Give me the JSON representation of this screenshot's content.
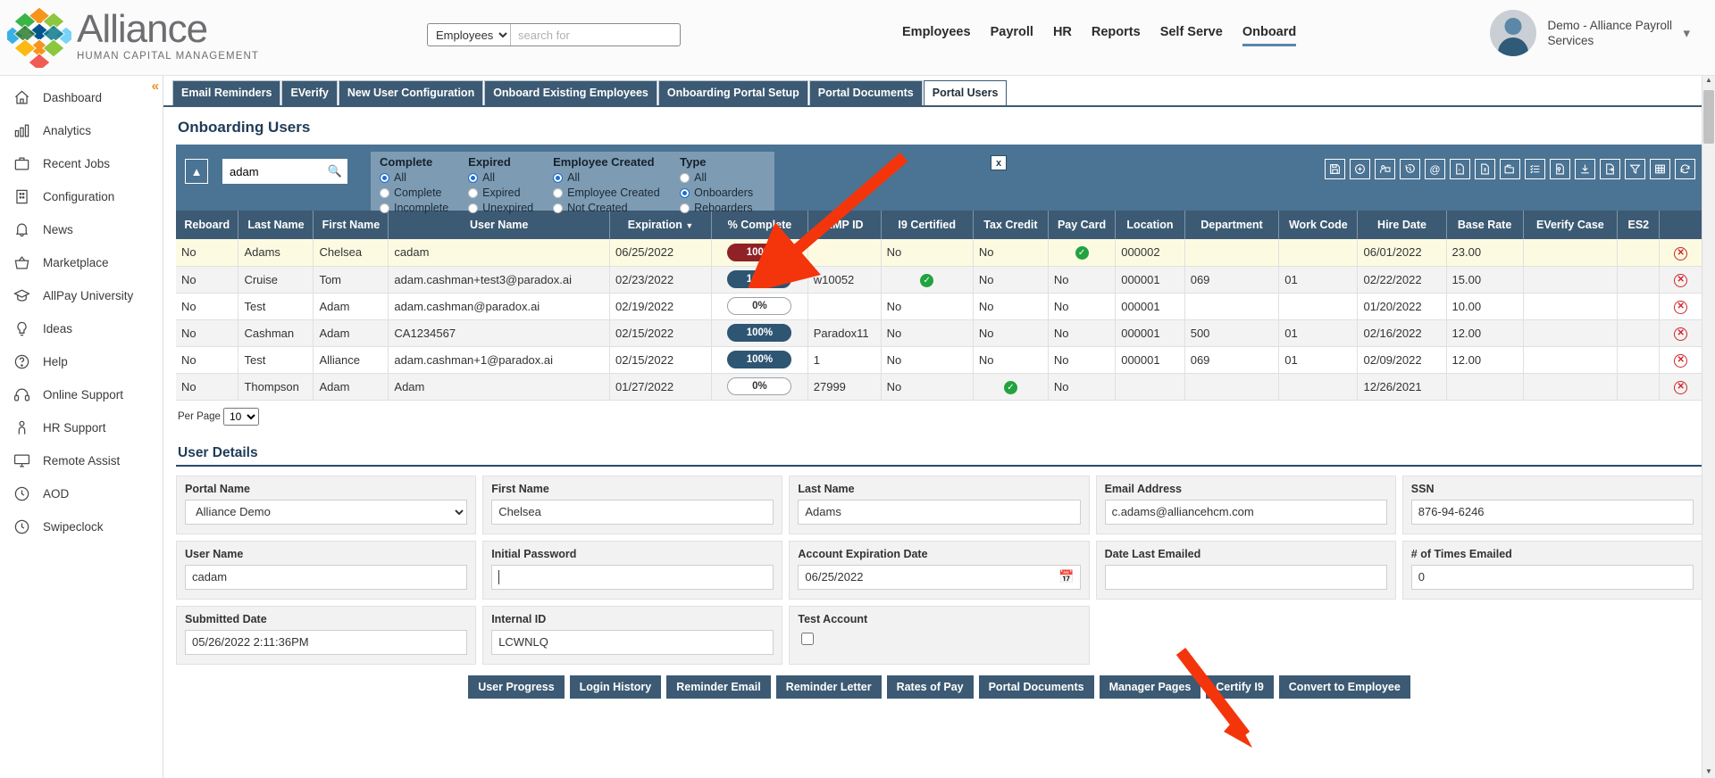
{
  "brand": {
    "name": "Alliance",
    "tagline": "HUMAN CAPITAL MANAGEMENT"
  },
  "header": {
    "search": {
      "selected": "Employees",
      "placeholder": "search for",
      "value": ""
    },
    "nav": [
      {
        "label": "Employees",
        "active": false
      },
      {
        "label": "Payroll",
        "active": false
      },
      {
        "label": "HR",
        "active": false
      },
      {
        "label": "Reports",
        "active": false
      },
      {
        "label": "Self Serve",
        "active": false
      },
      {
        "label": "Onboard",
        "active": true
      }
    ],
    "user": {
      "name": "Demo - Alliance Payroll Services",
      "caret": "chevron-down-icon"
    }
  },
  "sidebar": {
    "collapse": "«",
    "items": [
      {
        "label": "Dashboard",
        "icon": "home-icon"
      },
      {
        "label": "Analytics",
        "icon": "chart-icon"
      },
      {
        "label": "Recent Jobs",
        "icon": "briefcase-icon"
      },
      {
        "label": "Configuration",
        "icon": "building-icon"
      },
      {
        "label": "News",
        "icon": "bell-icon"
      },
      {
        "label": "Marketplace",
        "icon": "basket-icon"
      },
      {
        "label": "AllPay University",
        "icon": "graduation-cap-icon"
      },
      {
        "label": "Ideas",
        "icon": "lightbulb-icon"
      },
      {
        "label": "Help",
        "icon": "question-circle-icon"
      },
      {
        "label": "Online Support",
        "icon": "headset-icon"
      },
      {
        "label": "HR Support",
        "icon": "person-icon"
      },
      {
        "label": "Remote Assist",
        "icon": "monitor-icon"
      },
      {
        "label": "AOD",
        "icon": "clock-icon"
      },
      {
        "label": "Swipeclock",
        "icon": "clock-icon"
      }
    ]
  },
  "tabs": [
    {
      "label": "Email Reminders",
      "active": false
    },
    {
      "label": "EVerify",
      "active": false
    },
    {
      "label": "New User Configuration",
      "active": false
    },
    {
      "label": "Onboard Existing Employees",
      "active": false
    },
    {
      "label": "Onboarding Portal Setup",
      "active": false
    },
    {
      "label": "Portal Documents",
      "active": false
    },
    {
      "label": "Portal Users",
      "active": true
    }
  ],
  "panel": {
    "title": "Onboarding Users",
    "head_icons": [
      "grid-view-icon",
      "document-icon",
      "history-icon"
    ]
  },
  "filter": {
    "collapse_icon": "chevron-up-icon",
    "search_value": "adam",
    "search_icon": "search-icon",
    "close_label": "x",
    "groups": [
      {
        "title": "Complete",
        "options": [
          {
            "label": "All",
            "selected": true
          },
          {
            "label": "Complete",
            "selected": false
          },
          {
            "label": "Incomplete",
            "selected": false
          }
        ]
      },
      {
        "title": "Expired",
        "options": [
          {
            "label": "All",
            "selected": true
          },
          {
            "label": "Expired",
            "selected": false
          },
          {
            "label": "Unexpired",
            "selected": false
          }
        ]
      },
      {
        "title": "Employee Created",
        "options": [
          {
            "label": "All",
            "selected": true
          },
          {
            "label": "Employee Created",
            "selected": false
          },
          {
            "label": "Not Created",
            "selected": false
          }
        ]
      },
      {
        "title": "Type",
        "options": [
          {
            "label": "All",
            "selected": false
          },
          {
            "label": "Onboarders",
            "selected": true
          },
          {
            "label": "Reboarders",
            "selected": false
          }
        ]
      }
    ],
    "tools": [
      "save-icon",
      "add-icon",
      "assign-user-icon",
      "history-icon",
      "email-icon",
      "pdf-icon",
      "invoice-icon",
      "folders-icon",
      "checklist-icon",
      "tag-document-icon",
      "import-icon",
      "export-icon",
      "funnel-icon",
      "table-icon",
      "refresh-icon"
    ]
  },
  "table": {
    "columns": [
      "Reboard",
      "Last Name",
      "First Name",
      "User Name",
      "Expiration",
      "% Complete",
      "EMP ID",
      "I9 Certified",
      "Tax Credit",
      "Pay Card",
      "Location",
      "Department",
      "Work Code",
      "Hire Date",
      "Base Rate",
      "EVerify Case",
      "ES2",
      ""
    ],
    "sorted_column": "Expiration",
    "sort_indicator": "▼",
    "rows": [
      {
        "selected": true,
        "reboard": "No",
        "last": "Adams",
        "first": "Chelsea",
        "user": "cadam",
        "expiration": "06/25/2022",
        "pct": "100%",
        "pct_style": "red",
        "emp": "",
        "i9": "No",
        "tax": "No",
        "paycard": "check",
        "location": "000002",
        "dept": "",
        "work": "",
        "hire": "06/01/2022",
        "rate": "23.00",
        "everify": "",
        "es2": ""
      },
      {
        "selected": false,
        "reboard": "No",
        "last": "Cruise",
        "first": "Tom",
        "user": "adam.cashman+test3@paradox.ai",
        "expiration": "02/23/2022",
        "pct": "100%",
        "pct_style": "dark",
        "emp": "w10052",
        "i9": "check",
        "tax": "No",
        "paycard": "No",
        "location": "000001",
        "dept": "069",
        "work": "01",
        "hire": "02/22/2022",
        "rate": "15.00",
        "everify": "",
        "es2": ""
      },
      {
        "selected": false,
        "reboard": "No",
        "last": "Test",
        "first": "Adam",
        "user": "adam.cashman@paradox.ai",
        "expiration": "02/19/2022",
        "pct": "0%",
        "pct_style": "empty",
        "emp": "",
        "i9": "No",
        "tax": "No",
        "paycard": "No",
        "location": "000001",
        "dept": "",
        "work": "",
        "hire": "01/20/2022",
        "rate": "10.00",
        "everify": "",
        "es2": ""
      },
      {
        "selected": false,
        "reboard": "No",
        "last": "Cashman",
        "first": "Adam",
        "user": "CA1234567",
        "expiration": "02/15/2022",
        "pct": "100%",
        "pct_style": "dark",
        "emp": "Paradox11",
        "i9": "No",
        "tax": "No",
        "paycard": "No",
        "location": "000001",
        "dept": "500",
        "work": "01",
        "hire": "02/16/2022",
        "rate": "12.00",
        "everify": "",
        "es2": ""
      },
      {
        "selected": false,
        "reboard": "No",
        "last": "Test",
        "first": "Alliance",
        "user": "adam.cashman+1@paradox.ai",
        "expiration": "02/15/2022",
        "pct": "100%",
        "pct_style": "dark",
        "emp": "1",
        "i9": "No",
        "tax": "No",
        "paycard": "No",
        "location": "000001",
        "dept": "069",
        "work": "01",
        "hire": "02/09/2022",
        "rate": "12.00",
        "everify": "",
        "es2": ""
      },
      {
        "selected": false,
        "reboard": "No",
        "last": "Thompson",
        "first": "Adam",
        "user": "Adam",
        "expiration": "01/27/2022",
        "pct": "0%",
        "pct_style": "empty",
        "emp": "27999",
        "i9": "No",
        "tax": "check",
        "paycard": "No",
        "location": "",
        "dept": "",
        "work": "",
        "hire": "12/26/2021",
        "rate": "",
        "everify": "",
        "es2": ""
      }
    ],
    "per_page_label": "Per Page",
    "per_page_value": "10"
  },
  "details": {
    "title": "User Details",
    "fields": [
      {
        "label": "Portal Name",
        "value": "Alliance Demo",
        "type": "select"
      },
      {
        "label": "First Name",
        "value": "Chelsea",
        "type": "text"
      },
      {
        "label": "Last Name",
        "value": "Adams",
        "type": "text"
      },
      {
        "label": "Email Address",
        "value": "c.adams@alliancehcm.com",
        "type": "text"
      },
      {
        "label": "SSN",
        "value": "876-94-6246",
        "type": "text"
      },
      {
        "label": "User Name",
        "value": "cadam",
        "type": "text"
      },
      {
        "label": "Initial Password",
        "value": "",
        "type": "password"
      },
      {
        "label": "Account Expiration Date",
        "value": "06/25/2022",
        "type": "date"
      },
      {
        "label": "Date Last Emailed",
        "value": "",
        "type": "text"
      },
      {
        "label": "# of Times Emailed",
        "value": "0",
        "type": "text"
      },
      {
        "label": "Submitted Date",
        "value": "05/26/2022 2:11:36PM",
        "type": "text"
      },
      {
        "label": "Internal ID",
        "value": "LCWNLQ",
        "type": "text"
      },
      {
        "label": "Test Account",
        "value": "",
        "type": "checkbox"
      }
    ],
    "buttons": [
      {
        "label": "User Progress"
      },
      {
        "label": "Login History"
      },
      {
        "label": "Reminder Email"
      },
      {
        "label": "Reminder Letter"
      },
      {
        "label": "Rates of Pay"
      },
      {
        "label": "Portal Documents"
      },
      {
        "label": "Manager Pages"
      },
      {
        "label": "Certify I9"
      },
      {
        "label": "Convert to Employee"
      }
    ]
  },
  "annotations": {
    "arrow_color": "#f4350c",
    "arrow1_target": "% Complete badge",
    "arrow2_target": "Certify I9 button"
  }
}
